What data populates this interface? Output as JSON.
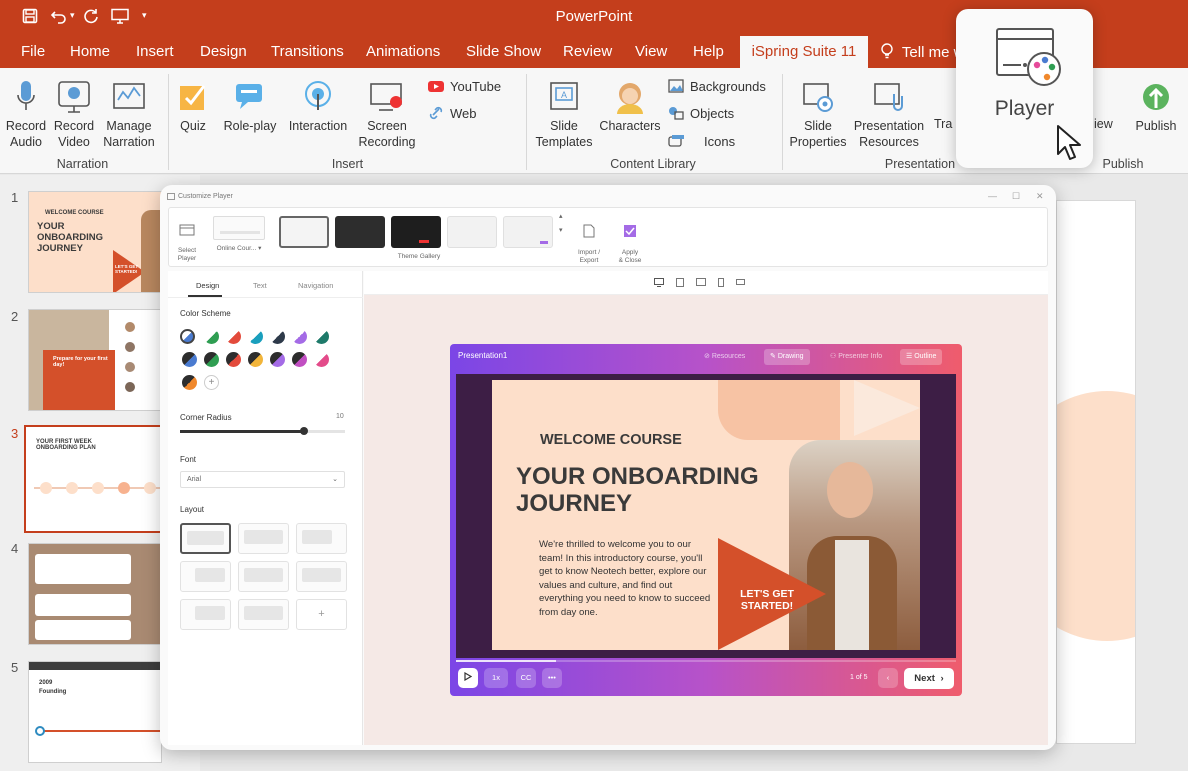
{
  "app": {
    "title": "PowerPoint"
  },
  "menu": {
    "items": [
      "File",
      "Home",
      "Insert",
      "Design",
      "Transitions",
      "Animations",
      "Slide Show",
      "Review",
      "View",
      "Help"
    ],
    "active": "iSpring Suite 11",
    "tell_me": "Tell me w"
  },
  "ribbon": {
    "narration": {
      "record_audio": "Record\nAudio",
      "record_video": "Record\nVideo",
      "manage_narration": "Manage\nNarration",
      "group": "Narration"
    },
    "insert": {
      "quiz": "Quiz",
      "roleplay": "Role-play",
      "interaction": "Interaction",
      "screen_recording": "Screen\nRecording",
      "youtube": "YouTube",
      "web": "Web",
      "group": "Insert"
    },
    "library": {
      "slide_templates": "Slide\nTemplates",
      "characters": "Characters",
      "backgrounds": "Backgrounds",
      "objects": "Objects",
      "icons": "Icons",
      "group": "Content Library"
    },
    "presentation": {
      "slide_properties": "Slide\nProperties",
      "presentation_resources": "Presentation\nResources",
      "tra": "Tra",
      "view": "iew",
      "group": "Presentation"
    },
    "publish": {
      "publish": "Publish",
      "group": "Publish"
    }
  },
  "slides": {
    "numbers": [
      "1",
      "2",
      "3",
      "4",
      "5"
    ],
    "thumb1": {
      "kicker": "WELCOME COURSE",
      "title": "YOUR ONBOARDING JOURNEY",
      "cta": "LET'S GET STARTED!"
    },
    "thumb2": {
      "title": "Prepare for your first day!"
    },
    "thumb3": {
      "title": "YOUR FIRST WEEK ONBOARDING PLAN"
    },
    "thumb5": {
      "year": "2009",
      "title": "Founding"
    }
  },
  "dialog": {
    "title": "Customize Player",
    "select_player": "Select\nPlayer",
    "player_name": "Online Cour...",
    "theme_gallery": "Theme Gallery",
    "import_export": "Import /\nExport",
    "apply_close": "Apply\n& Close",
    "tabs": [
      "Design",
      "Text",
      "Navigation"
    ],
    "color_scheme": "Color Scheme",
    "corner_radius": "Corner Radius",
    "corner_radius_value": "10",
    "corner_radius_level": 0.75,
    "font": "Font",
    "font_value": "Arial",
    "layout": "Layout",
    "add": "+"
  },
  "player": {
    "title": "Presentation1",
    "tabs": [
      {
        "label": "Resources",
        "active": false
      },
      {
        "label": "Drawing",
        "active": true
      },
      {
        "label": "Presenter Info",
        "active": false
      },
      {
        "label": "Outline",
        "active": true
      }
    ],
    "slide": {
      "kicker": "WELCOME COURSE",
      "headline": "YOUR ONBOARDING JOURNEY",
      "body": "We're thrilled to welcome you to our team! In this introductory course, you'll get to know Neotech better, explore our values and culture, and find out everything you need to know to succeed from day one.",
      "cta": "LET'S GET STARTED!"
    },
    "speed": "1x",
    "cc": "CC",
    "more": "•••",
    "page": "1 of 5",
    "next": "Next",
    "progress": 0.2
  },
  "popup": {
    "label": "Player"
  },
  "colors": {
    "brand": "#c43e1c",
    "accent": "#d4502a",
    "gradient_start": "#7b46e6",
    "gradient_end": "#ef5c6c"
  }
}
